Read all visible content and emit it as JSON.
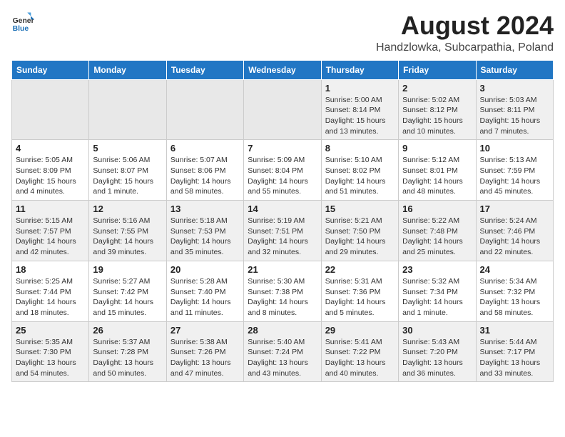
{
  "header": {
    "logo_general": "General",
    "logo_blue": "Blue",
    "title": "August 2024",
    "subtitle": "Handzlowka, Subcarpathia, Poland"
  },
  "weekdays": [
    "Sunday",
    "Monday",
    "Tuesday",
    "Wednesday",
    "Thursday",
    "Friday",
    "Saturday"
  ],
  "weeks": [
    [
      {
        "day": "",
        "info": ""
      },
      {
        "day": "",
        "info": ""
      },
      {
        "day": "",
        "info": ""
      },
      {
        "day": "",
        "info": ""
      },
      {
        "day": "1",
        "info": "Sunrise: 5:00 AM\nSunset: 8:14 PM\nDaylight: 15 hours\nand 13 minutes."
      },
      {
        "day": "2",
        "info": "Sunrise: 5:02 AM\nSunset: 8:12 PM\nDaylight: 15 hours\nand 10 minutes."
      },
      {
        "day": "3",
        "info": "Sunrise: 5:03 AM\nSunset: 8:11 PM\nDaylight: 15 hours\nand 7 minutes."
      }
    ],
    [
      {
        "day": "4",
        "info": "Sunrise: 5:05 AM\nSunset: 8:09 PM\nDaylight: 15 hours\nand 4 minutes."
      },
      {
        "day": "5",
        "info": "Sunrise: 5:06 AM\nSunset: 8:07 PM\nDaylight: 15 hours\nand 1 minute."
      },
      {
        "day": "6",
        "info": "Sunrise: 5:07 AM\nSunset: 8:06 PM\nDaylight: 14 hours\nand 58 minutes."
      },
      {
        "day": "7",
        "info": "Sunrise: 5:09 AM\nSunset: 8:04 PM\nDaylight: 14 hours\nand 55 minutes."
      },
      {
        "day": "8",
        "info": "Sunrise: 5:10 AM\nSunset: 8:02 PM\nDaylight: 14 hours\nand 51 minutes."
      },
      {
        "day": "9",
        "info": "Sunrise: 5:12 AM\nSunset: 8:01 PM\nDaylight: 14 hours\nand 48 minutes."
      },
      {
        "day": "10",
        "info": "Sunrise: 5:13 AM\nSunset: 7:59 PM\nDaylight: 14 hours\nand 45 minutes."
      }
    ],
    [
      {
        "day": "11",
        "info": "Sunrise: 5:15 AM\nSunset: 7:57 PM\nDaylight: 14 hours\nand 42 minutes."
      },
      {
        "day": "12",
        "info": "Sunrise: 5:16 AM\nSunset: 7:55 PM\nDaylight: 14 hours\nand 39 minutes."
      },
      {
        "day": "13",
        "info": "Sunrise: 5:18 AM\nSunset: 7:53 PM\nDaylight: 14 hours\nand 35 minutes."
      },
      {
        "day": "14",
        "info": "Sunrise: 5:19 AM\nSunset: 7:51 PM\nDaylight: 14 hours\nand 32 minutes."
      },
      {
        "day": "15",
        "info": "Sunrise: 5:21 AM\nSunset: 7:50 PM\nDaylight: 14 hours\nand 29 minutes."
      },
      {
        "day": "16",
        "info": "Sunrise: 5:22 AM\nSunset: 7:48 PM\nDaylight: 14 hours\nand 25 minutes."
      },
      {
        "day": "17",
        "info": "Sunrise: 5:24 AM\nSunset: 7:46 PM\nDaylight: 14 hours\nand 22 minutes."
      }
    ],
    [
      {
        "day": "18",
        "info": "Sunrise: 5:25 AM\nSunset: 7:44 PM\nDaylight: 14 hours\nand 18 minutes."
      },
      {
        "day": "19",
        "info": "Sunrise: 5:27 AM\nSunset: 7:42 PM\nDaylight: 14 hours\nand 15 minutes."
      },
      {
        "day": "20",
        "info": "Sunrise: 5:28 AM\nSunset: 7:40 PM\nDaylight: 14 hours\nand 11 minutes."
      },
      {
        "day": "21",
        "info": "Sunrise: 5:30 AM\nSunset: 7:38 PM\nDaylight: 14 hours\nand 8 minutes."
      },
      {
        "day": "22",
        "info": "Sunrise: 5:31 AM\nSunset: 7:36 PM\nDaylight: 14 hours\nand 5 minutes."
      },
      {
        "day": "23",
        "info": "Sunrise: 5:32 AM\nSunset: 7:34 PM\nDaylight: 14 hours\nand 1 minute."
      },
      {
        "day": "24",
        "info": "Sunrise: 5:34 AM\nSunset: 7:32 PM\nDaylight: 13 hours\nand 58 minutes."
      }
    ],
    [
      {
        "day": "25",
        "info": "Sunrise: 5:35 AM\nSunset: 7:30 PM\nDaylight: 13 hours\nand 54 minutes."
      },
      {
        "day": "26",
        "info": "Sunrise: 5:37 AM\nSunset: 7:28 PM\nDaylight: 13 hours\nand 50 minutes."
      },
      {
        "day": "27",
        "info": "Sunrise: 5:38 AM\nSunset: 7:26 PM\nDaylight: 13 hours\nand 47 minutes."
      },
      {
        "day": "28",
        "info": "Sunrise: 5:40 AM\nSunset: 7:24 PM\nDaylight: 13 hours\nand 43 minutes."
      },
      {
        "day": "29",
        "info": "Sunrise: 5:41 AM\nSunset: 7:22 PM\nDaylight: 13 hours\nand 40 minutes."
      },
      {
        "day": "30",
        "info": "Sunrise: 5:43 AM\nSunset: 7:20 PM\nDaylight: 13 hours\nand 36 minutes."
      },
      {
        "day": "31",
        "info": "Sunrise: 5:44 AM\nSunset: 7:17 PM\nDaylight: 13 hours\nand 33 minutes."
      }
    ]
  ]
}
